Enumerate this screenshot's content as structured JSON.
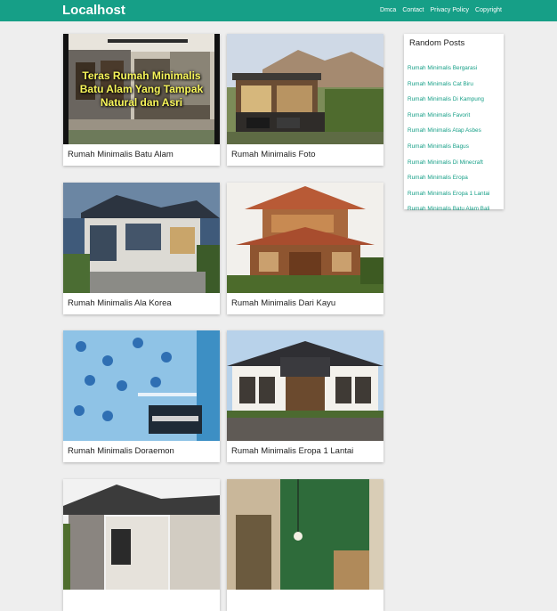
{
  "header": {
    "brand": "Localhost",
    "links": [
      "Dmca",
      "Contact",
      "Privacy Policy",
      "Copyright"
    ]
  },
  "posts": [
    {
      "title": "Rumah Minimalis Batu Alam",
      "overlay": "Teras Rumah Minimalis Batu Alam Yang Tampak Natural dan Asri"
    },
    {
      "title": "Rumah Minimalis Foto"
    },
    {
      "title": "Rumah Minimalis Ala Korea"
    },
    {
      "title": "Rumah Minimalis Dari Kayu"
    },
    {
      "title": "Rumah Minimalis Doraemon"
    },
    {
      "title": "Rumah Minimalis Eropa 1 Lantai"
    },
    {
      "title": ""
    },
    {
      "title": ""
    }
  ],
  "sidebar": {
    "heading": "Random Posts",
    "items": [
      "Rumah Minimalis Bergarasi",
      "Rumah Minimalis Cat Biru",
      "Rumah Minimalis Di Kampung",
      "Rumah Minimalis Favorit",
      "Rumah Minimalis Atap Asbes",
      "Rumah Minimalis Bagus",
      "Rumah Minimalis Di Minecraft",
      "Rumah Minimalis Eropa",
      "Rumah Minimalis Eropa 1 Lantai",
      "Rumah Minimalis Batu Alam Bali"
    ]
  },
  "colors": {
    "accent": "#169f87",
    "background": "#eeeeee"
  }
}
